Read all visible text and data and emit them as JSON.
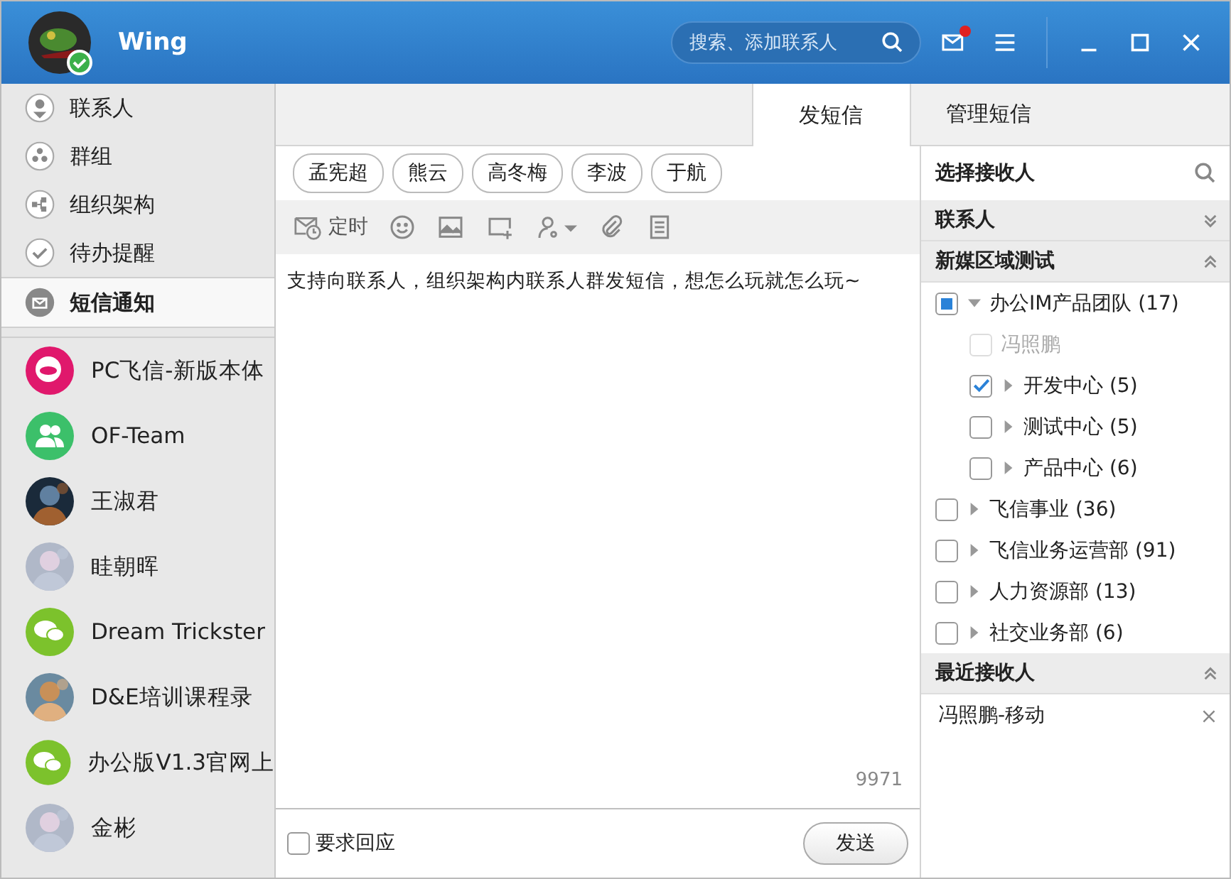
{
  "header": {
    "user": "Wing",
    "search": {
      "placeholder": "搜索、添加联系人"
    },
    "mail_unread": true
  },
  "nav": [
    {
      "kind": "contacts",
      "label": "联系人",
      "selected": false
    },
    {
      "kind": "groups",
      "label": "群组",
      "selected": false
    },
    {
      "kind": "org",
      "label": "组织架构",
      "selected": false
    },
    {
      "kind": "todo",
      "label": "待办提醒",
      "selected": false
    },
    {
      "kind": "sms",
      "label": "短信通知",
      "selected": true
    }
  ],
  "chats": [
    {
      "kind": "logo",
      "name": "PC飞信-新版本体"
    },
    {
      "kind": "team",
      "name": "OF-Team"
    },
    {
      "name": "王淑君"
    },
    {
      "name": "眭朝晖"
    },
    {
      "kind": "chat",
      "name": "Dream Trickster"
    },
    {
      "name": "D&E培训课程录"
    },
    {
      "kind": "chat",
      "name": "办公版V1.3官网上"
    },
    {
      "name": "金彬"
    }
  ],
  "tabs": [
    {
      "label": "发短信",
      "selected": true
    },
    {
      "label": "管理短信",
      "selected": false
    }
  ],
  "recipients": [
    "孟宪超",
    "熊云",
    "高冬梅",
    "李波",
    "于航"
  ],
  "toolbar": {
    "timer_label": "定时"
  },
  "message": "支持向联系人，组织架构内联系人群发短信，想怎么玩就怎么玩~",
  "char_count": "9971",
  "require_reply": {
    "label": "要求回应",
    "checked": false
  },
  "send_button": "发送",
  "picker": {
    "title": "选择接收人",
    "sections": [
      {
        "title": "联系人",
        "expanded": false
      },
      {
        "title": "新媒区域测试",
        "expanded": true,
        "tree": [
          {
            "kind": "group",
            "label": "办公IM产品团队 (17)",
            "checked": false,
            "partial": true,
            "expanded": true,
            "children": [
              {
                "kind": "person",
                "label": "冯照鹏",
                "checked": false,
                "disabled": true
              },
              {
                "kind": "group",
                "label": "开发中心 (5)",
                "checked": true,
                "expanded": false
              },
              {
                "kind": "group",
                "label": "测试中心 (5)",
                "checked": false,
                "expanded": false
              },
              {
                "kind": "group",
                "label": "产品中心 (6)",
                "checked": false,
                "expanded": false
              }
            ]
          },
          {
            "kind": "group",
            "label": "飞信事业 (36)",
            "checked": false,
            "expanded": false
          },
          {
            "kind": "group",
            "label": "飞信业务运营部 (91)",
            "checked": false,
            "expanded": false
          },
          {
            "kind": "group",
            "label": "人力资源部 (13)",
            "checked": false,
            "expanded": false
          },
          {
            "kind": "group",
            "label": "社交业务部 (6)",
            "checked": false,
            "expanded": false
          }
        ]
      },
      {
        "title": "最近接收人",
        "expanded": true,
        "recent": [
          "冯照鹏-移动"
        ]
      }
    ]
  }
}
